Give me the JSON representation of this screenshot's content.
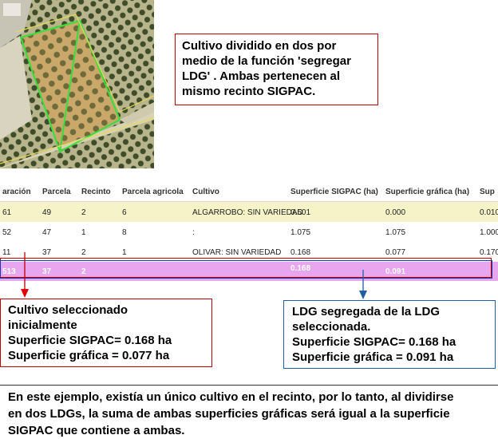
{
  "callouts": {
    "top": [
      "Cultivo dividido en dos por",
      "medio de la función 'segregar",
      "LDG' . Ambas pertenecen al",
      "mismo recinto SIGPAC."
    ],
    "left": [
      "Cultivo seleccionado",
      "inicialmente",
      "Superficie SIGPAC= 0.168 ha",
      "Superficie gráfica = 0.077 ha"
    ],
    "right": [
      "LDG segregada de la LDG",
      "seleccionada.",
      "Superficie SIGPAC= 0.168 ha",
      "Superficie gráfica = 0.091 ha"
    ],
    "bottom": [
      "En este ejemplo, existía un único cultivo en el recinto, por lo tanto, al dividirse",
      "en dos LDGs, la suma de ambas superficies gráficas será igual a la superficie",
      "SIGPAC que contiene a ambas."
    ]
  },
  "table": {
    "headers": [
      "aración",
      "Parcela",
      "Recinto",
      "Parcela agricola",
      "Cultivo",
      "Superficie SIGPAC (ha)",
      "Superficie gráfica (ha)",
      "Sup"
    ],
    "rows": [
      [
        "61",
        "49",
        "2",
        "6",
        "ALGARROBO: SIN VARIEDAD",
        "0.501",
        "0.000",
        "0.010"
      ],
      [
        "52",
        "47",
        "1",
        "8",
        ":",
        "1.075",
        "1.075",
        "1.000"
      ],
      [
        "11",
        "37",
        "2",
        "1",
        "OLIVAR: SIN VARIEDAD",
        "0.168",
        "0.077",
        "0.170"
      ],
      [
        "513",
        "37",
        "2",
        "",
        "",
        "0.168",
        "0.091",
        ""
      ]
    ]
  },
  "colors": {
    "highlight_row": "#f6f3c8",
    "selected_row": "#e8a6ee",
    "callout_red": "#c00000",
    "callout_blue": "#1f5fa8"
  }
}
